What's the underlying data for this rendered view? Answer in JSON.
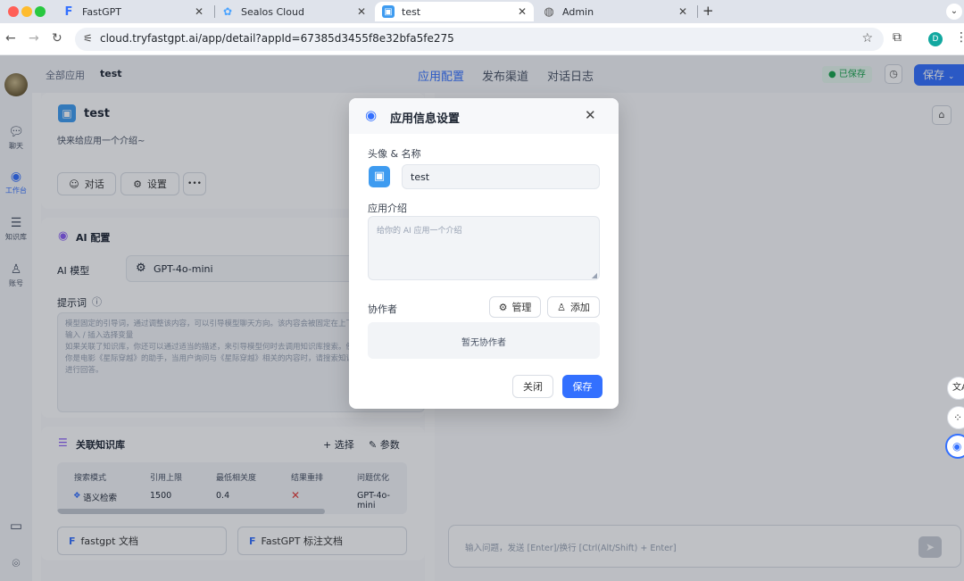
{
  "browser": {
    "tabs": [
      {
        "title": "FastGPT"
      },
      {
        "title": "Sealos Cloud"
      },
      {
        "title": "test"
      },
      {
        "title": "Admin"
      }
    ],
    "new_tab": "+",
    "url": "cloud.tryfastgpt.ai/app/detail?appId=67385d3455f8e32bfa5fe275",
    "profile_initial": "D"
  },
  "rail": {
    "items": [
      {
        "label": "聊天",
        "icon": "chat-icon"
      },
      {
        "label": "工作台",
        "icon": "robot-icon"
      },
      {
        "label": "知识库",
        "icon": "database-icon"
      },
      {
        "label": "账号",
        "icon": "user-icon"
      }
    ]
  },
  "header": {
    "breadcrumb_root": "全部应用",
    "breadcrumb_current": "test",
    "tabs": [
      "应用配置",
      "发布渠道",
      "对话日志"
    ],
    "saved_label": "● 已保存",
    "save_label": "保存"
  },
  "app": {
    "name": "test",
    "intro": "快来给应用一个介绍~",
    "chat_btn": "对话",
    "settings_btn": "设置",
    "more_btn": "•••"
  },
  "ai_config": {
    "title": "AI 配置",
    "model_label": "AI 模型",
    "model_value": "GPT-4o-mini",
    "prompt_label": "提示词",
    "prompt_placeholder": "模型固定的引导词，通过调整该内容，可以引导模型聊天方向。该内容会被固定在上下文的开头。可通过输入 / 插入选择变量\n如果关联了知识库，你还可以通过适当的描述，来引导模型何时去调用知识库搜索。例如：\n你是电影《星际穿越》的助手，当用户询问与《星际穿越》相关的内容时，请搜索知识库并结合搜索结果进行回答。"
  },
  "knowledge": {
    "title": "关联知识库",
    "select_label": "+ 选择",
    "params_label": "参数",
    "columns": [
      "搜索模式",
      "引用上限",
      "最低相关度",
      "结果重排",
      "问题优化"
    ],
    "row": [
      "语义检索",
      "1500",
      "0.4",
      "✕",
      "GPT-4o-mini"
    ],
    "datasets": [
      "fastgpt 文档",
      "FastGPT 标注文档"
    ]
  },
  "chat": {
    "input_placeholder": "输入问题，发送 [Enter]/换行 [Ctrl(Alt/Shift) + Enter]"
  },
  "modal": {
    "title": "应用信息设置",
    "avatar_name_label": "头像 & 名称",
    "name_value": "test",
    "intro_label": "应用介绍",
    "intro_placeholder": "给你的 AI 应用一个介绍",
    "collaborators_label": "协作者",
    "manage_label": "管理",
    "add_label": "添加",
    "empty_collaborators": "暂无协作者",
    "close_label": "关闭",
    "save_label": "保存"
  },
  "colors": {
    "accent": "#3370ff",
    "saved_green": "#16a34a",
    "danger": "#e53935"
  }
}
